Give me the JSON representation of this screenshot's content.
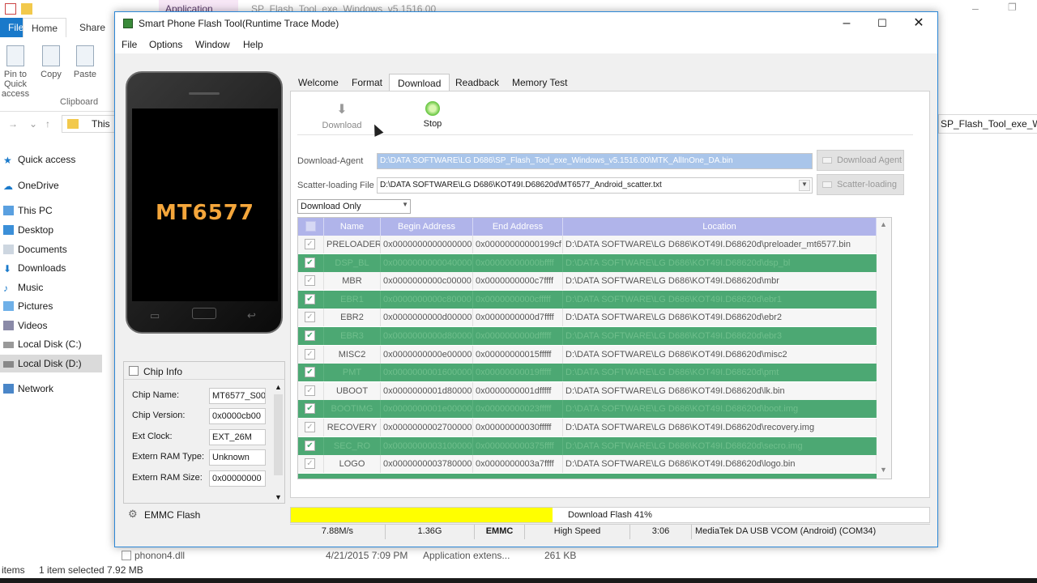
{
  "explorer": {
    "app_tools": "Application Tools",
    "title": "SP_Flash_Tool_exe_Windows_v5.1516.00",
    "tabs": [
      "File",
      "Home",
      "Share"
    ],
    "ribbon": {
      "pin": "Pin to Quick access",
      "copy": "Copy",
      "paste": "Paste",
      "group": "Clipboard"
    },
    "address": "This",
    "right_address": "SP_Flash_Tool_exe_Wi...",
    "nav": [
      "Quick access",
      "OneDrive",
      "This PC",
      "Desktop",
      "Documents",
      "Downloads",
      "Music",
      "Pictures",
      "Videos",
      "Local Disk (C:)",
      "Local Disk (D:)",
      "Network"
    ],
    "file_row": {
      "name": "phonon4.dll",
      "date": "4/21/2015 7:09 PM",
      "type": "Application extens...",
      "size": "261 KB"
    },
    "status": {
      "items": "items",
      "selected": "1 item selected  7.92 MB"
    }
  },
  "window": {
    "title": "Smart Phone Flash Tool(Runtime Trace Mode)",
    "menu": [
      "File",
      "Options",
      "Window",
      "Help"
    ]
  },
  "phone": {
    "chip": "MT6577"
  },
  "chip_info": {
    "header": "Chip Info",
    "rows": [
      {
        "label": "Chip Name:",
        "value": "MT6577_S00"
      },
      {
        "label": "Chip Version:",
        "value": "0x0000cb00"
      },
      {
        "label": "Ext Clock:",
        "value": "EXT_26M"
      },
      {
        "label": "Extern RAM Type:",
        "value": "Unknown"
      },
      {
        "label": "Extern RAM Size:",
        "value": "0x00000000"
      }
    ]
  },
  "emmc": "EMMC Flash",
  "tabs": [
    "Welcome",
    "Format",
    "Download",
    "Readback",
    "Memory Test"
  ],
  "toolbar": {
    "download": "Download",
    "stop": "Stop"
  },
  "download_agent": {
    "label": "Download-Agent",
    "path": "D:\\DATA SOFTWARE\\LG D686\\SP_Flash_Tool_exe_Windows_v5.1516.00\\MTK_AllInOne_DA.bin",
    "button": "Download Agent"
  },
  "scatter": {
    "label": "Scatter-loading File",
    "path": "D:\\DATA SOFTWARE\\LG D686\\KOT49I.D68620d\\MT6577_Android_scatter.txt",
    "button": "Scatter-loading"
  },
  "mode": "Download Only",
  "table": {
    "columns": [
      "Name",
      "Begin Address",
      "End Address",
      "Location"
    ],
    "rows": [
      {
        "name": "PRELOADER",
        "begin": "0x0000000000000000",
        "end": "0x00000000000199cf",
        "location": "D:\\DATA SOFTWARE\\LG D686\\KOT49I.D68620d\\preloader_mt6577.bin",
        "checked": false,
        "highlight": false
      },
      {
        "name": "DSP_BL",
        "begin": "0x0000000000040000",
        "end": "0x00000000000bffff",
        "location": "D:\\DATA SOFTWARE\\LG D686\\KOT49I.D68620d\\dsp_bl",
        "checked": true,
        "highlight": true
      },
      {
        "name": "MBR",
        "begin": "0x0000000000c00000",
        "end": "0x0000000000c7ffff",
        "location": "D:\\DATA SOFTWARE\\LG D686\\KOT49I.D68620d\\mbr",
        "checked": false,
        "highlight": false
      },
      {
        "name": "EBR1",
        "begin": "0x0000000000c80000",
        "end": "0x0000000000cfffff",
        "location": "D:\\DATA SOFTWARE\\LG D686\\KOT49I.D68620d\\ebr1",
        "checked": true,
        "highlight": true
      },
      {
        "name": "EBR2",
        "begin": "0x0000000000d00000",
        "end": "0x0000000000d7ffff",
        "location": "D:\\DATA SOFTWARE\\LG D686\\KOT49I.D68620d\\ebr2",
        "checked": false,
        "highlight": false
      },
      {
        "name": "EBR3",
        "begin": "0x0000000000d80000",
        "end": "0x0000000000dfffff",
        "location": "D:\\DATA SOFTWARE\\LG D686\\KOT49I.D68620d\\ebr3",
        "checked": true,
        "highlight": true
      },
      {
        "name": "MISC2",
        "begin": "0x0000000000e00000",
        "end": "0x00000000015fffff",
        "location": "D:\\DATA SOFTWARE\\LG D686\\KOT49I.D68620d\\misc2",
        "checked": false,
        "highlight": false
      },
      {
        "name": "PMT",
        "begin": "0x0000000001600000",
        "end": "0x00000000019fffff",
        "location": "D:\\DATA SOFTWARE\\LG D686\\KOT49I.D68620d\\pmt",
        "checked": true,
        "highlight": true
      },
      {
        "name": "UBOOT",
        "begin": "0x0000000001d80000",
        "end": "0x0000000001dfffff",
        "location": "D:\\DATA SOFTWARE\\LG D686\\KOT49I.D68620d\\lk.bin",
        "checked": false,
        "highlight": false
      },
      {
        "name": "BOOTIMG",
        "begin": "0x0000000001e00000",
        "end": "0x00000000023fffff",
        "location": "D:\\DATA SOFTWARE\\LG D686\\KOT49I.D68620d\\boot.img",
        "checked": true,
        "highlight": true
      },
      {
        "name": "RECOVERY",
        "begin": "0x0000000002700000",
        "end": "0x00000000030fffff",
        "location": "D:\\DATA SOFTWARE\\LG D686\\KOT49I.D68620d\\recovery.img",
        "checked": false,
        "highlight": false
      },
      {
        "name": "SEC_RO",
        "begin": "0x0000000003100000",
        "end": "0x000000000375ffff",
        "location": "D:\\DATA SOFTWARE\\LG D686\\KOT49I.D68620d\\secro.img",
        "checked": true,
        "highlight": true
      },
      {
        "name": "LOGO",
        "begin": "0x0000000003780000",
        "end": "0x0000000003a7ffff",
        "location": "D:\\DATA SOFTWARE\\LG D686\\KOT49I.D68620d\\logo.bin",
        "checked": false,
        "highlight": false
      }
    ]
  },
  "progress": {
    "label": "Download Flash 41%",
    "percent": 41,
    "color": "#ffff00"
  },
  "status": {
    "speed": "7.88M/s",
    "size": "1.36G",
    "storage": "EMMC",
    "usb": "High Speed",
    "time": "3:06",
    "port": "MediaTek DA USB VCOM (Android) (COM34)"
  },
  "colors": {
    "row_highlight": "#4ca873",
    "table_header": "#b0b4ea",
    "accent": "#2c87d6"
  }
}
